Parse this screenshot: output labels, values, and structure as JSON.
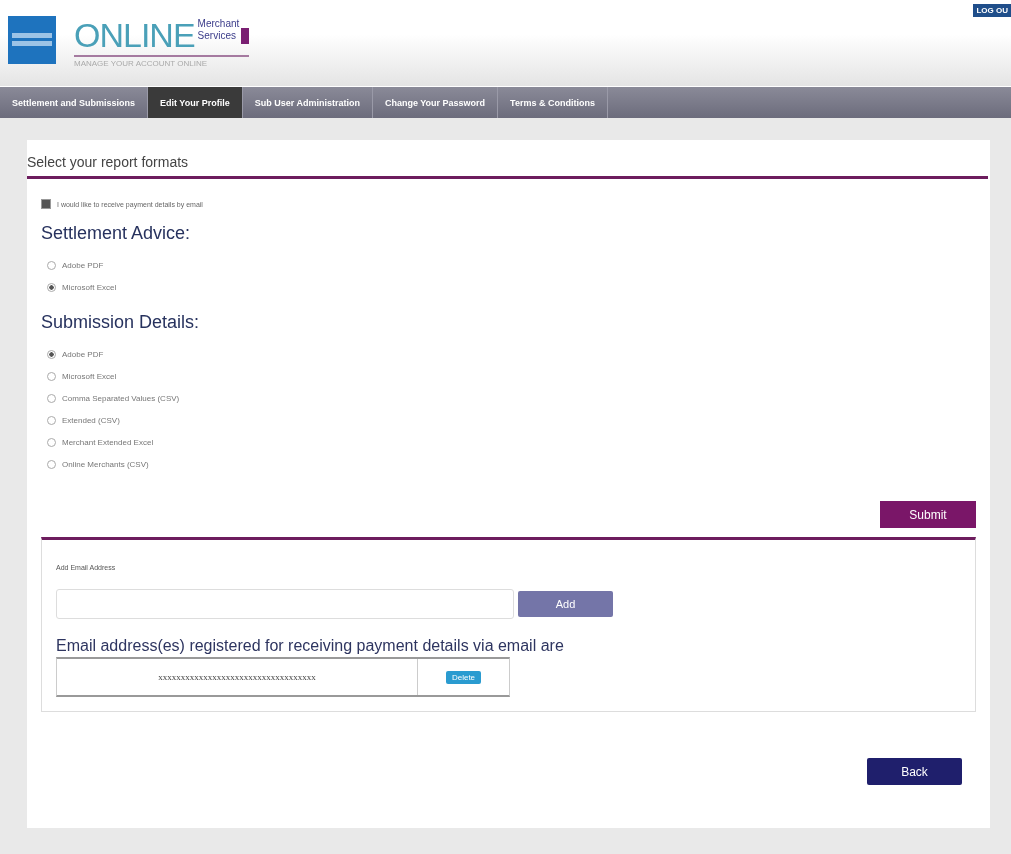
{
  "header": {
    "brand": "ONLINE",
    "brand_sub_1": "Merchant",
    "brand_sub_2": "Services",
    "tagline": "MANAGE YOUR ACCOUNT ONLINE",
    "logout": "LOG OU"
  },
  "tabs": [
    {
      "label": "Settlement and Submissions",
      "selected": false
    },
    {
      "label": "Edit Your Profile",
      "selected": true
    },
    {
      "label": "Sub User Administration",
      "selected": false
    },
    {
      "label": "Change Your Password",
      "selected": false
    },
    {
      "label": "Terms & Conditions",
      "selected": false
    }
  ],
  "page_title": "Select your report formats",
  "email_opt_in": {
    "label": "I would like to receive payment details by email",
    "checked": true
  },
  "groups": [
    {
      "title": "Settlement Advice:",
      "options": [
        {
          "label": "Adobe PDF",
          "selected": false
        },
        {
          "label": "Microsoft Excel",
          "selected": true
        }
      ]
    },
    {
      "title": "Submission Details:",
      "options": [
        {
          "label": "Adobe PDF",
          "selected": true
        },
        {
          "label": "Microsoft Excel",
          "selected": false
        },
        {
          "label": "Comma Separated Values (CSV)",
          "selected": false
        },
        {
          "label": "Extended (CSV)",
          "selected": false
        },
        {
          "label": "Merchant Extended Excel",
          "selected": false
        },
        {
          "label": "Online Merchants (CSV)",
          "selected": false
        }
      ]
    }
  ],
  "submit": "Submit",
  "add_email": {
    "label": "Add Email Address",
    "button": "Add"
  },
  "registered": {
    "title": "Email address(es) registered for receiving payment details via email are",
    "rows": [
      {
        "email": "xxxxxxxxxxxxxxxxxxxxxxxxxxxxxxxxxxx",
        "action": "Delete"
      }
    ]
  },
  "back": "Back"
}
